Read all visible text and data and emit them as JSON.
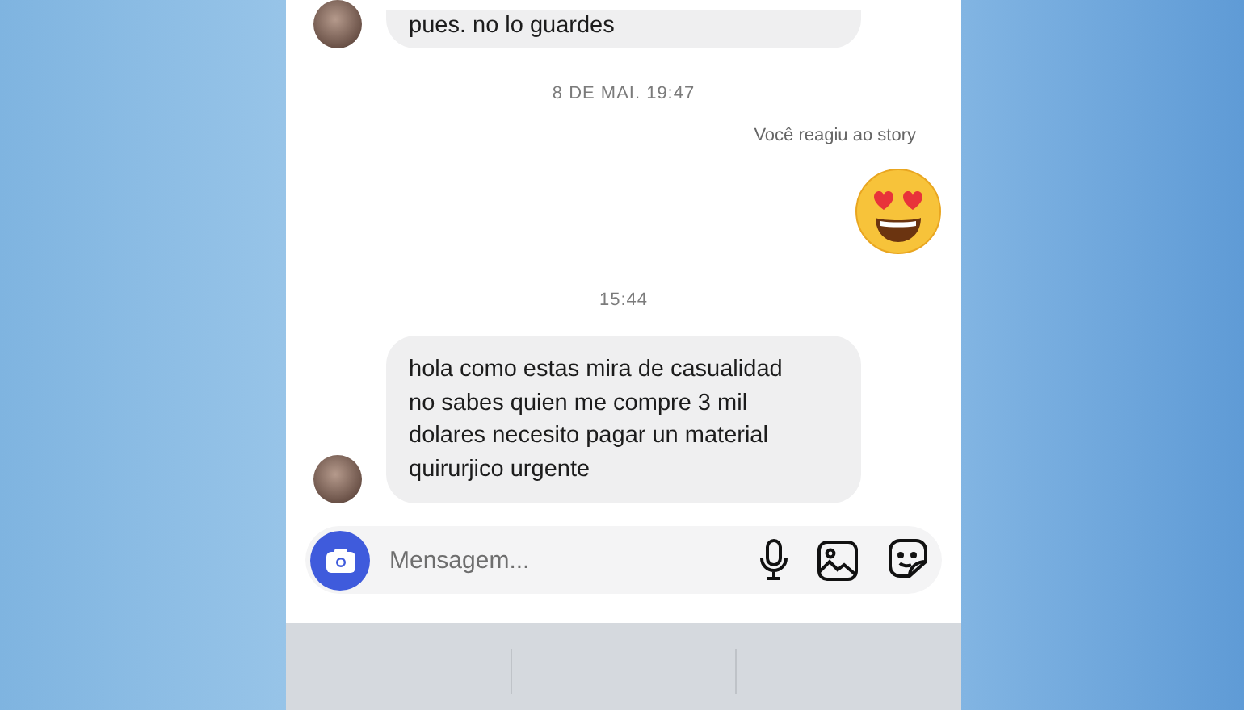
{
  "messages": [
    {
      "kind": "received",
      "text": "pues. no lo guardes"
    },
    {
      "kind": "timestamp",
      "text": "8 DE MAI. 19:47"
    },
    {
      "kind": "note",
      "text": "Você reagiu ao story"
    },
    {
      "kind": "reaction"
    },
    {
      "kind": "timestamp",
      "text": "15:44"
    },
    {
      "kind": "received",
      "text": "hola como estas mira de casualidad no sabes quien me compre 3 mil dolares necesito pagar un material quirurjico urgente"
    }
  ],
  "composer": {
    "placeholder": "Mensagem..."
  }
}
